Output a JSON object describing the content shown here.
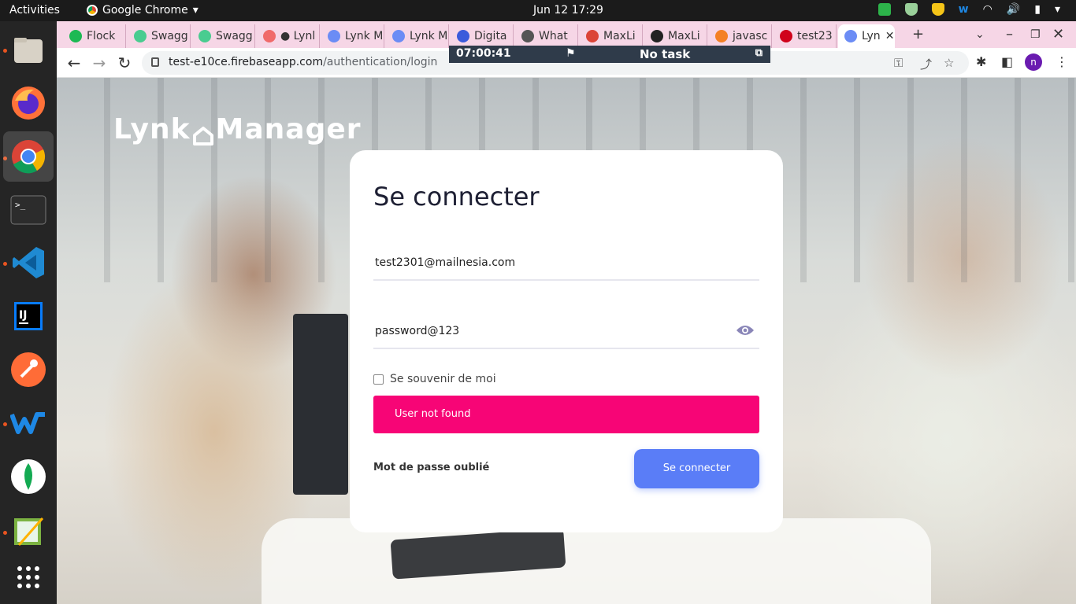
{
  "topbar": {
    "activities": "Activities",
    "app_name": "Google Chrome",
    "clock": "Jun 12  17:29"
  },
  "dock": {
    "items": [
      "files",
      "firefox",
      "chrome",
      "terminal",
      "vscode",
      "intellij",
      "postman",
      "webstorm",
      "mongodb",
      "notepad",
      "app-grid"
    ]
  },
  "tabs": [
    {
      "label": "Flock",
      "icon": "flock-icon",
      "color": "#1db954"
    },
    {
      "label": "Swagg",
      "icon": "swagger-icon",
      "color": "#49cc90"
    },
    {
      "label": "Swagg",
      "icon": "swagger-icon",
      "color": "#49cc90"
    },
    {
      "label": "● Lynl",
      "icon": "asana-icon",
      "color": "#f06a6a"
    },
    {
      "label": "Lynk M",
      "icon": "lynk-icon",
      "color": "#6b8cf5"
    },
    {
      "label": "Lynk M",
      "icon": "lynk-icon",
      "color": "#6b8cf5"
    },
    {
      "label": "Digita",
      "icon": "digital-icon",
      "color": "#3b5bdb"
    },
    {
      "label": "What",
      "icon": "globe-icon",
      "color": "#555555"
    },
    {
      "label": "MaxLi",
      "icon": "google-icon",
      "color": "#db4437"
    },
    {
      "label": "MaxLi",
      "icon": "github-icon",
      "color": "#222222"
    },
    {
      "label": "javasc",
      "icon": "stackoverflow-icon",
      "color": "#f48024"
    },
    {
      "label": "test23",
      "icon": "mail-icon",
      "color": "#d0021b"
    },
    {
      "label": "Lyn",
      "icon": "lynk-icon",
      "color": "#6b8cf5",
      "active": true
    }
  ],
  "address": {
    "host": "test-e10ce.firebaseapp.com",
    "path": "/authentication/login"
  },
  "timer": {
    "time": "07:00:41",
    "task": "No task"
  },
  "brand": {
    "part1": "Lynk",
    "part2": "Manager"
  },
  "login": {
    "title": "Se connecter",
    "email_value": "test2301@mailnesia.com",
    "password_value": "password@123",
    "remember_label": "Se souvenir de moi",
    "error": "User not found",
    "forgot_label": "Mot de passe oublié",
    "submit_label": "Se connecter"
  },
  "profile_initial": "n",
  "colors": {
    "accent": "#5a7df7",
    "error": "#f70576",
    "tabstrip": "#f6d6e6"
  }
}
